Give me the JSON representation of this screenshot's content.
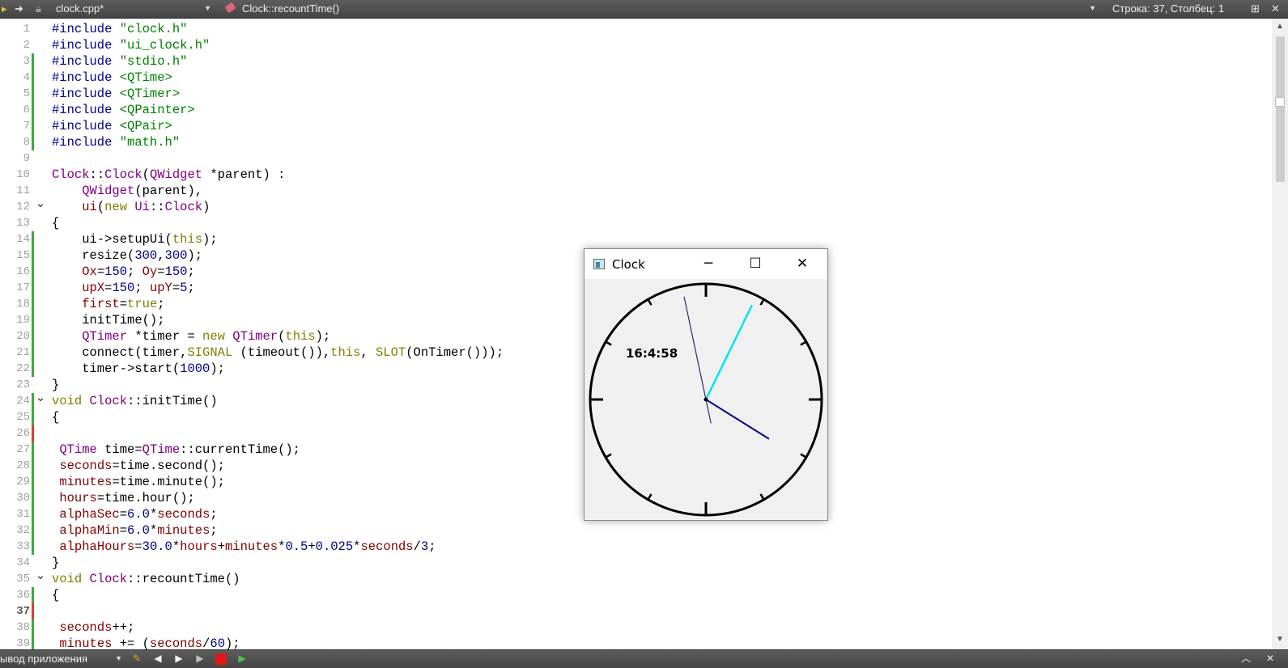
{
  "toolbar": {
    "file_name": "clock.cpp*",
    "function_name": "Clock::recountTime()",
    "cursor_position": "Строка: 37, Столбец: 1"
  },
  "editor": {
    "current_line": 37,
    "lines": [
      {
        "n": 1,
        "mark": "",
        "fold": "",
        "tokens": [
          [
            "pp",
            "#include "
          ],
          [
            "str",
            "\"clock.h\""
          ]
        ]
      },
      {
        "n": 2,
        "mark": "",
        "fold": "",
        "tokens": [
          [
            "pp",
            "#include "
          ],
          [
            "str",
            "\"ui_clock.h\""
          ]
        ]
      },
      {
        "n": 3,
        "mark": "g",
        "fold": "",
        "tokens": [
          [
            "pp",
            "#include "
          ],
          [
            "str",
            "\"stdio.h\""
          ]
        ]
      },
      {
        "n": 4,
        "mark": "g",
        "fold": "",
        "tokens": [
          [
            "pp",
            "#include "
          ],
          [
            "str",
            "<QTime>"
          ]
        ]
      },
      {
        "n": 5,
        "mark": "g",
        "fold": "",
        "tokens": [
          [
            "pp",
            "#include "
          ],
          [
            "str",
            "<QTimer>"
          ]
        ]
      },
      {
        "n": 6,
        "mark": "g",
        "fold": "",
        "tokens": [
          [
            "pp",
            "#include "
          ],
          [
            "str",
            "<QPainter>"
          ]
        ]
      },
      {
        "n": 7,
        "mark": "g",
        "fold": "",
        "tokens": [
          [
            "pp",
            "#include "
          ],
          [
            "str",
            "<QPair>"
          ]
        ]
      },
      {
        "n": 8,
        "mark": "g",
        "fold": "",
        "tokens": [
          [
            "pp",
            "#include "
          ],
          [
            "str",
            "\"math.h\""
          ]
        ]
      },
      {
        "n": 9,
        "mark": "",
        "fold": "",
        "tokens": []
      },
      {
        "n": 10,
        "mark": "",
        "fold": "",
        "tokens": [
          [
            "type",
            "Clock"
          ],
          [
            "pl",
            "::"
          ],
          [
            "type",
            "Clock"
          ],
          [
            "pl",
            "("
          ],
          [
            "type",
            "QWidget"
          ],
          [
            "pl",
            " *parent) :"
          ]
        ]
      },
      {
        "n": 11,
        "mark": "",
        "fold": "",
        "tokens": [
          [
            "pl",
            "    "
          ],
          [
            "type",
            "QWidget"
          ],
          [
            "pl",
            "(parent),"
          ]
        ]
      },
      {
        "n": 12,
        "mark": "",
        "fold": "v",
        "tokens": [
          [
            "pl",
            "    "
          ],
          [
            "var",
            "ui"
          ],
          [
            "pl",
            "("
          ],
          [
            "kw",
            "new"
          ],
          [
            "pl",
            " "
          ],
          [
            "type",
            "Ui"
          ],
          [
            "pl",
            "::"
          ],
          [
            "type",
            "Clock"
          ],
          [
            "pl",
            ")"
          ]
        ]
      },
      {
        "n": 13,
        "mark": "",
        "fold": "",
        "tokens": [
          [
            "pl",
            "{"
          ]
        ]
      },
      {
        "n": 14,
        "mark": "g",
        "fold": "",
        "tokens": [
          [
            "pl",
            "    ui->setupUi("
          ],
          [
            "kw",
            "this"
          ],
          [
            "pl",
            ");"
          ]
        ]
      },
      {
        "n": 15,
        "mark": "g",
        "fold": "",
        "tokens": [
          [
            "pl",
            "    resize("
          ],
          [
            "num",
            "300"
          ],
          [
            "pl",
            ","
          ],
          [
            "num",
            "300"
          ],
          [
            "pl",
            ");"
          ]
        ]
      },
      {
        "n": 16,
        "mark": "g",
        "fold": "",
        "tokens": [
          [
            "pl",
            "    "
          ],
          [
            "var",
            "Ox"
          ],
          [
            "pl",
            "="
          ],
          [
            "num",
            "150"
          ],
          [
            "pl",
            "; "
          ],
          [
            "var",
            "Oy"
          ],
          [
            "pl",
            "="
          ],
          [
            "num",
            "150"
          ],
          [
            "pl",
            ";"
          ]
        ]
      },
      {
        "n": 17,
        "mark": "g",
        "fold": "",
        "tokens": [
          [
            "pl",
            "    "
          ],
          [
            "var",
            "upX"
          ],
          [
            "pl",
            "="
          ],
          [
            "num",
            "150"
          ],
          [
            "pl",
            "; "
          ],
          [
            "var",
            "upY"
          ],
          [
            "pl",
            "="
          ],
          [
            "num",
            "5"
          ],
          [
            "pl",
            ";"
          ]
        ]
      },
      {
        "n": 18,
        "mark": "g",
        "fold": "",
        "tokens": [
          [
            "pl",
            "    "
          ],
          [
            "var",
            "first"
          ],
          [
            "pl",
            "="
          ],
          [
            "kw",
            "true"
          ],
          [
            "pl",
            ";"
          ]
        ]
      },
      {
        "n": 19,
        "mark": "g",
        "fold": "",
        "tokens": [
          [
            "pl",
            "    initTime();"
          ]
        ]
      },
      {
        "n": 20,
        "mark": "g",
        "fold": "",
        "tokens": [
          [
            "pl",
            "    "
          ],
          [
            "type",
            "QTimer"
          ],
          [
            "pl",
            " *timer = "
          ],
          [
            "kw",
            "new"
          ],
          [
            "pl",
            " "
          ],
          [
            "type",
            "QTimer"
          ],
          [
            "pl",
            "("
          ],
          [
            "kw",
            "this"
          ],
          [
            "pl",
            ");"
          ]
        ]
      },
      {
        "n": 21,
        "mark": "g",
        "fold": "",
        "tokens": [
          [
            "pl",
            "    connect(timer,"
          ],
          [
            "kw",
            "SIGNAL"
          ],
          [
            "pl",
            " (timeout()),"
          ],
          [
            "kw",
            "this"
          ],
          [
            "pl",
            ", "
          ],
          [
            "kw",
            "SLOT"
          ],
          [
            "pl",
            "(OnTimer()));"
          ]
        ]
      },
      {
        "n": 22,
        "mark": "g",
        "fold": "",
        "tokens": [
          [
            "pl",
            "    timer->start("
          ],
          [
            "num",
            "1000"
          ],
          [
            "pl",
            ");"
          ]
        ]
      },
      {
        "n": 23,
        "mark": "",
        "fold": "",
        "tokens": [
          [
            "pl",
            "}"
          ]
        ]
      },
      {
        "n": 24,
        "mark": "g",
        "fold": "v",
        "tokens": [
          [
            "kw",
            "void"
          ],
          [
            "pl",
            " "
          ],
          [
            "type",
            "Clock"
          ],
          [
            "pl",
            "::initTime()"
          ]
        ]
      },
      {
        "n": 25,
        "mark": "g",
        "fold": "",
        "tokens": [
          [
            "pl",
            "{"
          ]
        ]
      },
      {
        "n": 26,
        "mark": "r",
        "fold": "",
        "tokens": []
      },
      {
        "n": 27,
        "mark": "g",
        "fold": "",
        "tokens": [
          [
            "pl",
            " "
          ],
          [
            "type",
            "QTime"
          ],
          [
            "pl",
            " time="
          ],
          [
            "type",
            "QTime"
          ],
          [
            "pl",
            "::currentTime();"
          ]
        ]
      },
      {
        "n": 28,
        "mark": "g",
        "fold": "",
        "tokens": [
          [
            "pl",
            " "
          ],
          [
            "var",
            "seconds"
          ],
          [
            "pl",
            "=time.second();"
          ]
        ]
      },
      {
        "n": 29,
        "mark": "g",
        "fold": "",
        "tokens": [
          [
            "pl",
            " "
          ],
          [
            "var",
            "minutes"
          ],
          [
            "pl",
            "=time.minute();"
          ]
        ]
      },
      {
        "n": 30,
        "mark": "g",
        "fold": "",
        "tokens": [
          [
            "pl",
            " "
          ],
          [
            "var",
            "hours"
          ],
          [
            "pl",
            "=time.hour();"
          ]
        ]
      },
      {
        "n": 31,
        "mark": "g",
        "fold": "",
        "tokens": [
          [
            "pl",
            " "
          ],
          [
            "var",
            "alphaSec"
          ],
          [
            "pl",
            "="
          ],
          [
            "num",
            "6.0"
          ],
          [
            "pl",
            "*"
          ],
          [
            "var",
            "seconds"
          ],
          [
            "pl",
            ";"
          ]
        ]
      },
      {
        "n": 32,
        "mark": "g",
        "fold": "",
        "tokens": [
          [
            "pl",
            " "
          ],
          [
            "var",
            "alphaMin"
          ],
          [
            "pl",
            "="
          ],
          [
            "num",
            "6.0"
          ],
          [
            "pl",
            "*"
          ],
          [
            "var",
            "minutes"
          ],
          [
            "pl",
            ";"
          ]
        ]
      },
      {
        "n": 33,
        "mark": "g",
        "fold": "",
        "tokens": [
          [
            "pl",
            " "
          ],
          [
            "var",
            "alphaHours"
          ],
          [
            "pl",
            "="
          ],
          [
            "num",
            "30.0"
          ],
          [
            "pl",
            "*"
          ],
          [
            "var",
            "hours"
          ],
          [
            "pl",
            "+"
          ],
          [
            "var",
            "minutes"
          ],
          [
            "pl",
            "*"
          ],
          [
            "num",
            "0.5"
          ],
          [
            "pl",
            "+"
          ],
          [
            "num",
            "0.025"
          ],
          [
            "pl",
            "*"
          ],
          [
            "var",
            "seconds"
          ],
          [
            "pl",
            "/"
          ],
          [
            "num",
            "3"
          ],
          [
            "pl",
            ";"
          ]
        ]
      },
      {
        "n": 34,
        "mark": "",
        "fold": "",
        "tokens": [
          [
            "pl",
            "}"
          ]
        ]
      },
      {
        "n": 35,
        "mark": "",
        "fold": "v",
        "tokens": [
          [
            "kw",
            "void"
          ],
          [
            "pl",
            " "
          ],
          [
            "type",
            "Clock"
          ],
          [
            "pl",
            "::recountTime()"
          ]
        ]
      },
      {
        "n": 36,
        "mark": "g",
        "fold": "",
        "tokens": [
          [
            "pl",
            "{"
          ]
        ]
      },
      {
        "n": 37,
        "mark": "r",
        "fold": "",
        "tokens": []
      },
      {
        "n": 38,
        "mark": "g",
        "fold": "",
        "tokens": [
          [
            "pl",
            " "
          ],
          [
            "var",
            "seconds"
          ],
          [
            "pl",
            "++;"
          ]
        ]
      },
      {
        "n": 39,
        "mark": "g",
        "fold": "",
        "tokens": [
          [
            "pl",
            " "
          ],
          [
            "var",
            "minutes"
          ],
          [
            "pl",
            " += ("
          ],
          [
            "var",
            "seconds"
          ],
          [
            "pl",
            "/"
          ],
          [
            "num",
            "60"
          ],
          [
            "pl",
            ");"
          ]
        ]
      }
    ]
  },
  "clock_window": {
    "title": "Clock",
    "time_text": "16:4:58",
    "hands": {
      "hour_deg": 122,
      "minute_deg": 26,
      "second_deg": 348
    },
    "colors": {
      "hour_hand": "#00008b",
      "minute_hand": "#00e5ee",
      "second_hand": "#2a2a6e",
      "dial": "#000000",
      "face": "#f0f0f0"
    }
  },
  "bottombar": {
    "panel_label": "ывод приложения"
  },
  "colors": {
    "preprocessor": "#000080",
    "string": "#008000",
    "type": "#800080",
    "keyword": "#808000",
    "number": "#000080",
    "member": "#800000",
    "toolbar_bg": "#4e4e4e"
  }
}
